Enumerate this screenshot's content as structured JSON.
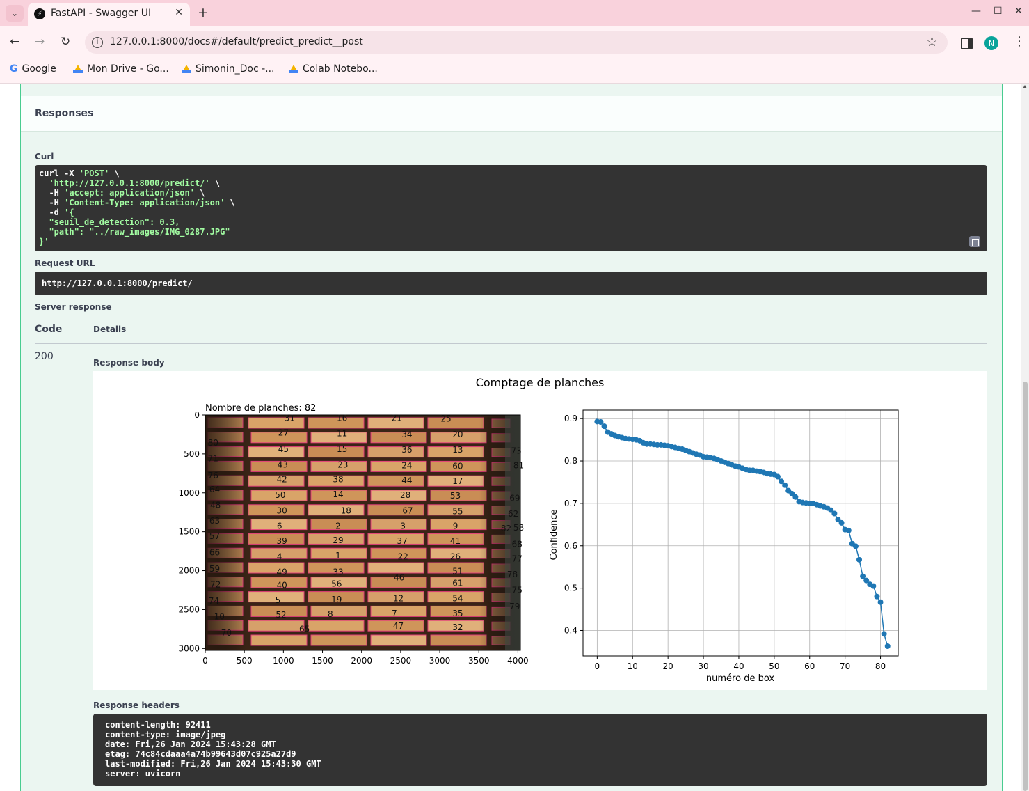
{
  "browser": {
    "tab_title": "FastAPI - Swagger UI",
    "url": "127.0.0.1:8000/docs#/default/predict_predict__post",
    "bookmarks": [
      {
        "label": "Google",
        "icon": "google-icon"
      },
      {
        "label": "Mon Drive - Go...",
        "icon": "drive-icon"
      },
      {
        "label": "Simonin_Doc -...",
        "icon": "drive-icon"
      },
      {
        "label": "Colab Notebo...",
        "icon": "drive-icon"
      }
    ],
    "profile_initial": "N",
    "tab_close_glyph": "✕",
    "new_tab_glyph": "+",
    "back_glyph": "←",
    "forward_glyph": "→",
    "reload_glyph": "↻",
    "star_glyph": "☆",
    "kebab_glyph": "⋮",
    "minimize_glyph": "—",
    "maximize_glyph": "☐",
    "close_glyph": "✕",
    "tab_menu_glyph": "⌄",
    "info_glyph": "i"
  },
  "responses": {
    "title": "Responses",
    "curl_label": "Curl",
    "curl": {
      "line1_cmd": "curl -X ",
      "line1_method": "'POST'",
      "line1_end": " \\",
      "line2_url": "'http://127.0.0.1:8000/predict/'",
      "line2_end": " \\",
      "line3_flag": "-H ",
      "line3_val": "'accept: application/json'",
      "line3_end": " \\",
      "line4_flag": "-H ",
      "line4_val": "'Content-Type: application/json'",
      "line4_end": " \\",
      "line5_flag": "-d ",
      "line5_val": "'{",
      "line6": "\"seuil_de_detection\": 0.3,",
      "line7": "\"path\": \"../raw_images/IMG_0287.JPG\"",
      "line8": "}'"
    },
    "request_url_label": "Request URL",
    "request_url": "http://127.0.0.1:8000/predict/",
    "server_response_label": "Server response",
    "col_code": "Code",
    "col_details": "Details",
    "status_code": "200",
    "response_body_label": "Response body",
    "response_headers_label": "Response headers",
    "headers": [
      "content-length: 92411",
      "content-type: image/jpeg",
      "date: Fri,26 Jan 2024 15:43:28 GMT",
      "etag: 74c84cdaaa4a74b99643d07c925a27d9",
      "last-modified: Fri,26 Jan 2024 15:43:30 GMT",
      "server: uvicorn"
    ]
  },
  "figure": {
    "suptitle": "Comptage de planches",
    "image_panel": {
      "title": "Nombre de planches: 82",
      "x_ticks": [
        "0",
        "500",
        "1000",
        "1500",
        "2000",
        "2500",
        "3000",
        "3500",
        "4000"
      ],
      "y_ticks": [
        "0",
        "500",
        "1000",
        "1500",
        "2000",
        "2500",
        "3000"
      ],
      "box_labels": [
        {
          "n": "31",
          "x": 1080,
          "y": 30
        },
        {
          "n": "16",
          "x": 1750,
          "y": 30
        },
        {
          "n": "21",
          "x": 2450,
          "y": 30
        },
        {
          "n": "25",
          "x": 3080,
          "y": 40
        },
        {
          "n": "27",
          "x": 1000,
          "y": 220
        },
        {
          "n": "11",
          "x": 1750,
          "y": 230
        },
        {
          "n": "34",
          "x": 2580,
          "y": 240
        },
        {
          "n": "20",
          "x": 3230,
          "y": 240
        },
        {
          "n": "80",
          "x": 100,
          "y": 350
        },
        {
          "n": "45",
          "x": 1000,
          "y": 430
        },
        {
          "n": "15",
          "x": 1750,
          "y": 430
        },
        {
          "n": "36",
          "x": 2580,
          "y": 440
        },
        {
          "n": "13",
          "x": 3230,
          "y": 440
        },
        {
          "n": "73",
          "x": 3980,
          "y": 450
        },
        {
          "n": "71",
          "x": 100,
          "y": 550
        },
        {
          "n": "43",
          "x": 990,
          "y": 630
        },
        {
          "n": "23",
          "x": 1760,
          "y": 630
        },
        {
          "n": "24",
          "x": 2580,
          "y": 640
        },
        {
          "n": "60",
          "x": 3230,
          "y": 650
        },
        {
          "n": "81",
          "x": 4010,
          "y": 640
        },
        {
          "n": "76",
          "x": 100,
          "y": 770
        },
        {
          "n": "42",
          "x": 980,
          "y": 820
        },
        {
          "n": "38",
          "x": 1700,
          "y": 820
        },
        {
          "n": "44",
          "x": 2580,
          "y": 830
        },
        {
          "n": "17",
          "x": 3230,
          "y": 840
        },
        {
          "n": "64",
          "x": 120,
          "y": 950
        },
        {
          "n": "50",
          "x": 960,
          "y": 1020
        },
        {
          "n": "14",
          "x": 1700,
          "y": 1010
        },
        {
          "n": "28",
          "x": 2560,
          "y": 1020
        },
        {
          "n": "53",
          "x": 3200,
          "y": 1030
        },
        {
          "n": "69",
          "x": 3960,
          "y": 1060
        },
        {
          "n": "48",
          "x": 130,
          "y": 1150
        },
        {
          "n": "30",
          "x": 980,
          "y": 1220
        },
        {
          "n": "18",
          "x": 1800,
          "y": 1220
        },
        {
          "n": "67",
          "x": 2590,
          "y": 1220
        },
        {
          "n": "55",
          "x": 3230,
          "y": 1230
        },
        {
          "n": "62",
          "x": 3940,
          "y": 1260
        },
        {
          "n": "63",
          "x": 120,
          "y": 1350
        },
        {
          "n": "6",
          "x": 950,
          "y": 1420
        },
        {
          "n": "2",
          "x": 1700,
          "y": 1420
        },
        {
          "n": "3",
          "x": 2530,
          "y": 1420
        },
        {
          "n": "9",
          "x": 3200,
          "y": 1420
        },
        {
          "n": "82",
          "x": 3850,
          "y": 1450
        },
        {
          "n": "58",
          "x": 4010,
          "y": 1440
        },
        {
          "n": "57",
          "x": 120,
          "y": 1550
        },
        {
          "n": "39",
          "x": 980,
          "y": 1610
        },
        {
          "n": "29",
          "x": 1700,
          "y": 1600
        },
        {
          "n": "37",
          "x": 2520,
          "y": 1610
        },
        {
          "n": "41",
          "x": 3200,
          "y": 1610
        },
        {
          "n": "68",
          "x": 3990,
          "y": 1650
        },
        {
          "n": "66",
          "x": 120,
          "y": 1760
        },
        {
          "n": "4",
          "x": 950,
          "y": 1810
        },
        {
          "n": "1",
          "x": 1700,
          "y": 1800
        },
        {
          "n": "22",
          "x": 2530,
          "y": 1810
        },
        {
          "n": "26",
          "x": 3200,
          "y": 1810
        },
        {
          "n": "77",
          "x": 3990,
          "y": 1840
        },
        {
          "n": "59",
          "x": 120,
          "y": 1970
        },
        {
          "n": "49",
          "x": 980,
          "y": 2010
        },
        {
          "n": "33",
          "x": 1700,
          "y": 2010
        },
        {
          "n": "46",
          "x": 2480,
          "y": 2080
        },
        {
          "n": "51",
          "x": 3230,
          "y": 2000
        },
        {
          "n": "78",
          "x": 3930,
          "y": 2040
        },
        {
          "n": "72",
          "x": 130,
          "y": 2170
        },
        {
          "n": "40",
          "x": 980,
          "y": 2180
        },
        {
          "n": "56",
          "x": 1680,
          "y": 2160
        },
        {
          "n": "61",
          "x": 3230,
          "y": 2150
        },
        {
          "n": "75",
          "x": 3990,
          "y": 2240
        },
        {
          "n": "74",
          "x": 110,
          "y": 2380
        },
        {
          "n": "5",
          "x": 930,
          "y": 2370
        },
        {
          "n": "19",
          "x": 1680,
          "y": 2360
        },
        {
          "n": "12",
          "x": 2470,
          "y": 2350
        },
        {
          "n": "54",
          "x": 3230,
          "y": 2350
        },
        {
          "n": "79",
          "x": 3960,
          "y": 2450
        },
        {
          "n": "10",
          "x": 180,
          "y": 2580
        },
        {
          "n": "52",
          "x": 970,
          "y": 2560
        },
        {
          "n": "8",
          "x": 1600,
          "y": 2550
        },
        {
          "n": "7",
          "x": 2420,
          "y": 2540
        },
        {
          "n": "35",
          "x": 3230,
          "y": 2540
        },
        {
          "n": "70",
          "x": 270,
          "y": 2790
        },
        {
          "n": "65",
          "x": 1270,
          "y": 2740
        },
        {
          "n": "47",
          "x": 2470,
          "y": 2700
        },
        {
          "n": "32",
          "x": 3230,
          "y": 2720
        }
      ]
    },
    "confidence_panel": {
      "xlabel": "numéro de box",
      "ylabel": "Confidence",
      "x_ticks": [
        0,
        10,
        20,
        30,
        40,
        50,
        60,
        70,
        80
      ],
      "y_ticks": [
        0.4,
        0.5,
        0.6,
        0.7,
        0.8,
        0.9
      ],
      "xlim": [
        -4,
        85
      ],
      "ylim": [
        0.34,
        0.92
      ],
      "color": "#1f77b4"
    }
  },
  "chart_data": {
    "type": "line",
    "title": "",
    "xlabel": "numéro de box",
    "ylabel": "Confidence",
    "xlim": [
      -4,
      85
    ],
    "ylim": [
      0.34,
      0.92
    ],
    "grid": true,
    "x": [
      0,
      1,
      2,
      3,
      4,
      5,
      6,
      7,
      8,
      9,
      10,
      11,
      12,
      13,
      14,
      15,
      16,
      17,
      18,
      19,
      20,
      21,
      22,
      23,
      24,
      25,
      26,
      27,
      28,
      29,
      30,
      31,
      32,
      33,
      34,
      35,
      36,
      37,
      38,
      39,
      40,
      41,
      42,
      43,
      44,
      45,
      46,
      47,
      48,
      49,
      50,
      51,
      52,
      53,
      54,
      55,
      56,
      57,
      58,
      59,
      60,
      61,
      62,
      63,
      64,
      65,
      66,
      67,
      68,
      69,
      70,
      71,
      72,
      73,
      74,
      75,
      76,
      77,
      78,
      79,
      80,
      81
    ],
    "series": [
      {
        "values": [
          0.893,
          0.892,
          0.882,
          0.868,
          0.864,
          0.86,
          0.857,
          0.855,
          0.853,
          0.852,
          0.851,
          0.85,
          0.848,
          0.843,
          0.84,
          0.84,
          0.839,
          0.838,
          0.838,
          0.837,
          0.836,
          0.834,
          0.832,
          0.83,
          0.828,
          0.825,
          0.822,
          0.819,
          0.816,
          0.814,
          0.81,
          0.809,
          0.808,
          0.806,
          0.803,
          0.8,
          0.797,
          0.794,
          0.791,
          0.788,
          0.786,
          0.783,
          0.78,
          0.778,
          0.778,
          0.776,
          0.775,
          0.773,
          0.77,
          0.769,
          0.768,
          0.763,
          0.752,
          0.743,
          0.73,
          0.723,
          0.715,
          0.704,
          0.702,
          0.701,
          0.7,
          0.7,
          0.697,
          0.694,
          0.692,
          0.689,
          0.684,
          0.676,
          0.662,
          0.654,
          0.638,
          0.636,
          0.605,
          0.599,
          0.567,
          0.528,
          0.518,
          0.509,
          0.505,
          0.48,
          0.467,
          0.392,
          0.363
        ]
      }
    ]
  }
}
